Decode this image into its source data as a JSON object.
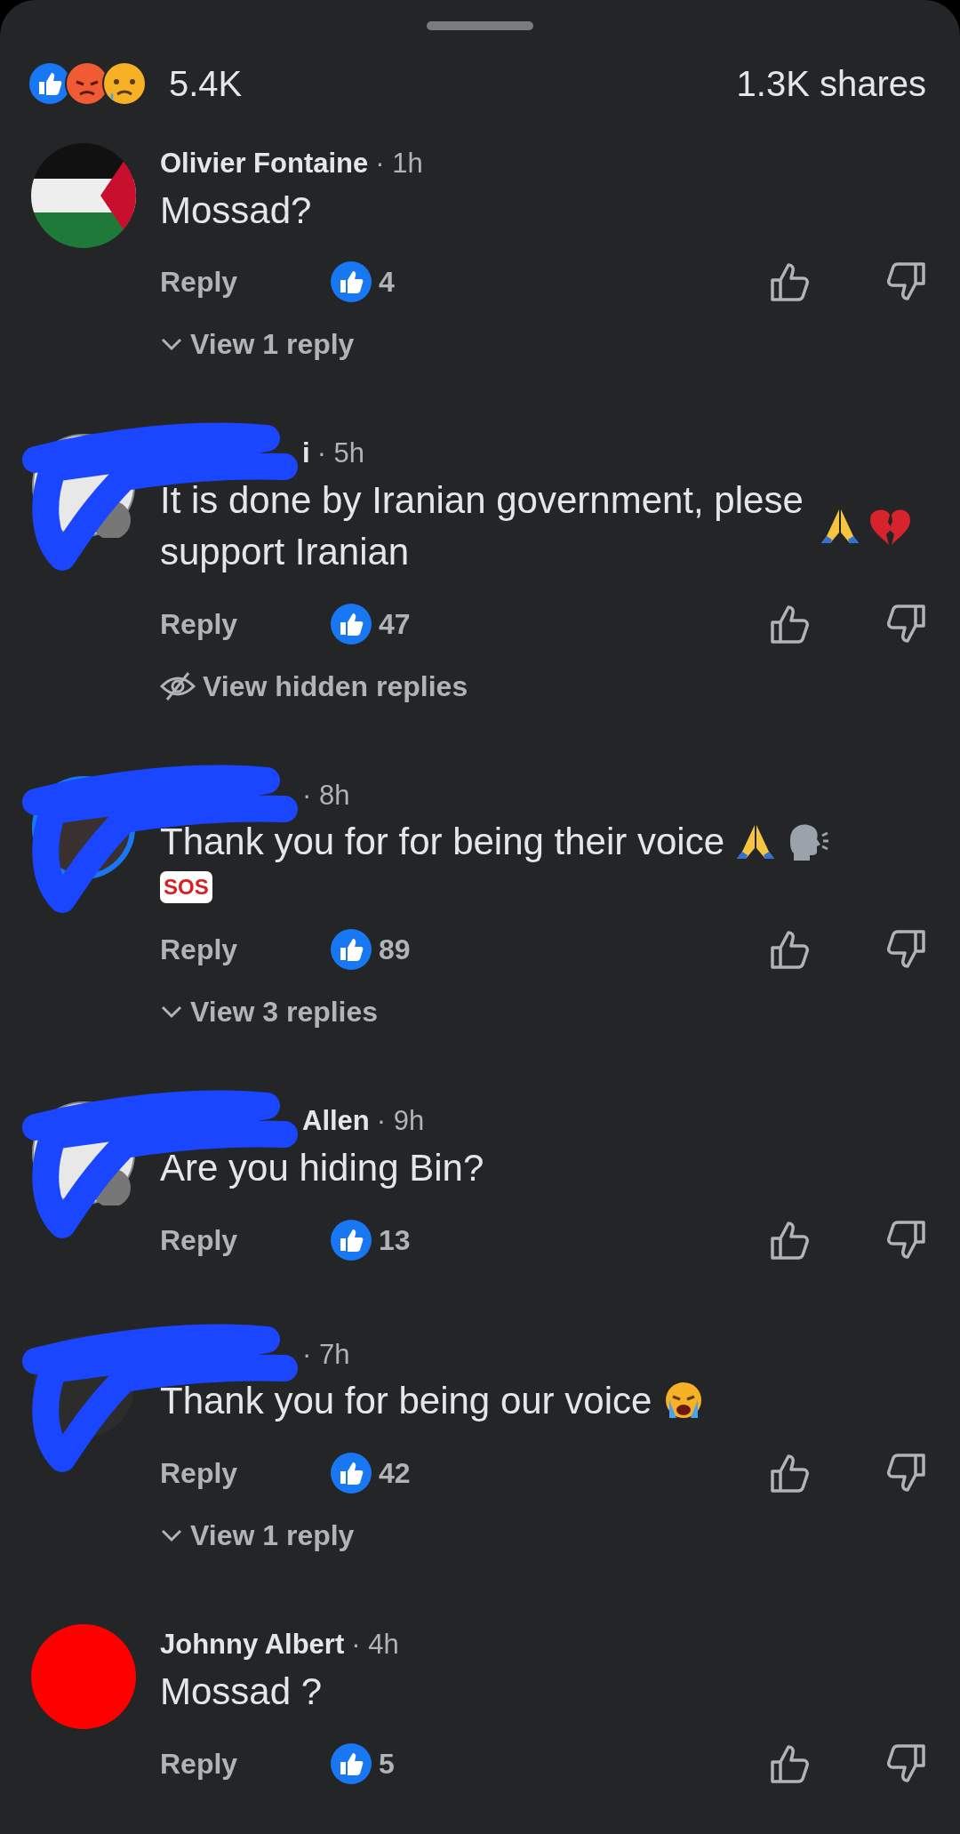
{
  "summary": {
    "reaction_count": "5.4K",
    "shares": "1.3K shares"
  },
  "comments": [
    {
      "redacted": false,
      "name": "Olivier Fontaine",
      "time": "· 1h",
      "text": "Mossad?",
      "reply": "Reply",
      "likes": "4",
      "replies": {
        "kind": "expand",
        "label": "View 1 reply"
      }
    },
    {
      "redacted": true,
      "name": "i",
      "time": "· 5h",
      "text": "It is done by Iranian government, plese support Iranian",
      "reply": "Reply",
      "likes": "47",
      "replies": {
        "kind": "hidden",
        "label": "View hidden replies"
      }
    },
    {
      "redacted": true,
      "time": "· 8h",
      "text": "Thank you for for being their voice",
      "badge": "SOS",
      "reply": "Reply",
      "likes": "89",
      "replies": {
        "kind": "expand",
        "label": "View 3 replies"
      }
    },
    {
      "redacted": true,
      "name": "Allen",
      "time": "· 9h",
      "text": "Are you hiding Bin?",
      "reply": "Reply",
      "likes": "13"
    },
    {
      "redacted": true,
      "time": "· 7h",
      "text": "Thank you for being our voice",
      "reply": "Reply",
      "likes": "42",
      "replies": {
        "kind": "expand",
        "label": "View 1 reply"
      }
    },
    {
      "redacted": false,
      "name": "Johnny Albert",
      "time": "· 4h",
      "text": "Mossad ?",
      "reply": "Reply",
      "likes": "5"
    }
  ]
}
